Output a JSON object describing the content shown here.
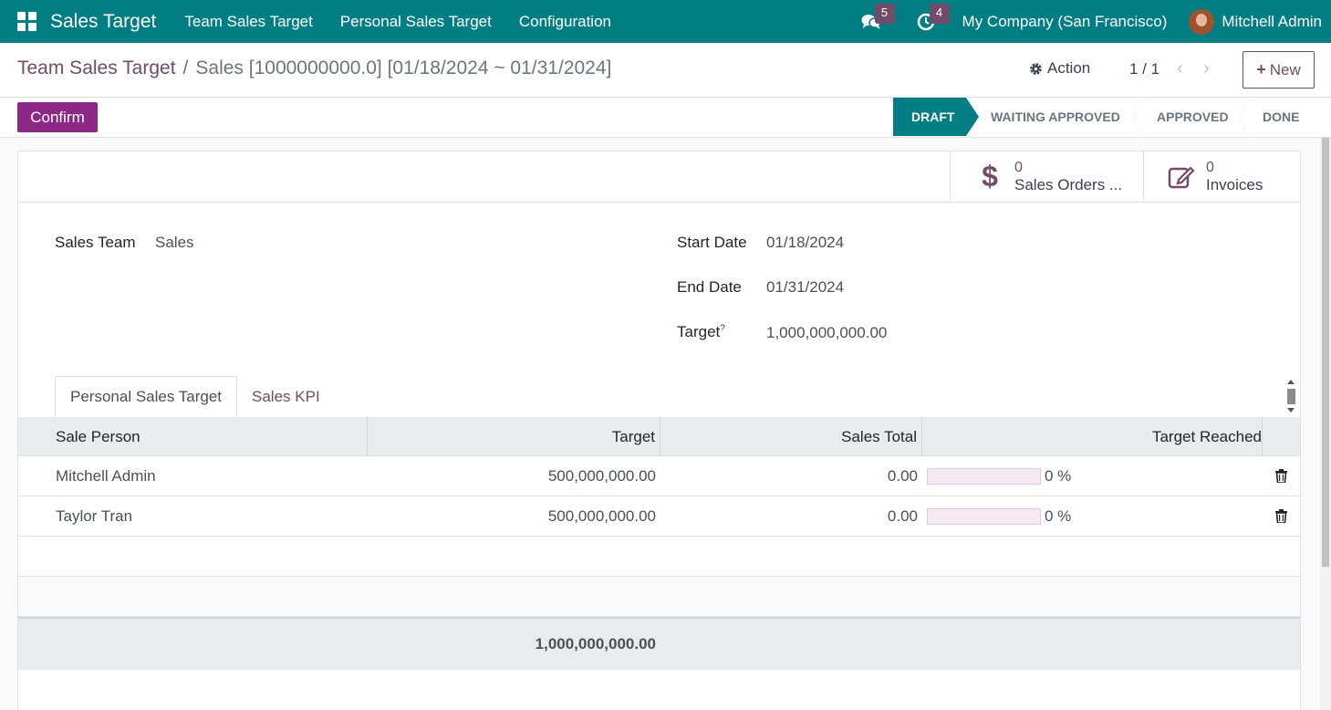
{
  "navbar": {
    "app_name": "Sales Target",
    "menu": [
      "Team Sales Target",
      "Personal Sales Target",
      "Configuration"
    ],
    "messages_count": "5",
    "activities_count": "4",
    "company": "My Company (San Francisco)",
    "user": "Mitchell Admin"
  },
  "control": {
    "breadcrumb_parent": "Team Sales Target",
    "breadcrumb_separator": "/",
    "breadcrumb_current": "Sales [1000000000.0] [01/18/2024 ~ 01/31/2024]",
    "action_label": "Action",
    "pager": "1 / 1",
    "new_label": "New"
  },
  "statusbar": {
    "confirm_label": "Confirm",
    "stages": [
      "DRAFT",
      "WAITING APPROVED",
      "APPROVED",
      "DONE"
    ],
    "active_stage": "DRAFT"
  },
  "smart_buttons": {
    "sales_orders": {
      "value": "0",
      "label": "Sales Orders ..."
    },
    "invoices": {
      "value": "0",
      "label": "Invoices"
    }
  },
  "form": {
    "sales_team_label": "Sales Team",
    "sales_team_value": "Sales",
    "start_date_label": "Start Date",
    "start_date_value": "01/18/2024",
    "end_date_label": "End Date",
    "end_date_value": "01/31/2024",
    "target_label": "Target",
    "target_tooltip": "?",
    "target_value": "1,000,000,000.00"
  },
  "tabs": [
    "Personal Sales Target",
    "Sales KPI"
  ],
  "table": {
    "headers": [
      "Sale Person",
      "Target",
      "Sales Total",
      "Target Reached"
    ],
    "rows": [
      {
        "person": "Mitchell Admin",
        "target": "500,000,000.00",
        "sales_total": "0.00",
        "reached": "0 %",
        "reached_fraction": 0
      },
      {
        "person": "Taylor Tran",
        "target": "500,000,000.00",
        "sales_total": "0.00",
        "reached": "0 %",
        "reached_fraction": 0
      }
    ],
    "total_target": "1,000,000,000.00"
  },
  "colors": {
    "navbar": "#017e84",
    "accent": "#714b67",
    "confirm": "#8e2886"
  }
}
